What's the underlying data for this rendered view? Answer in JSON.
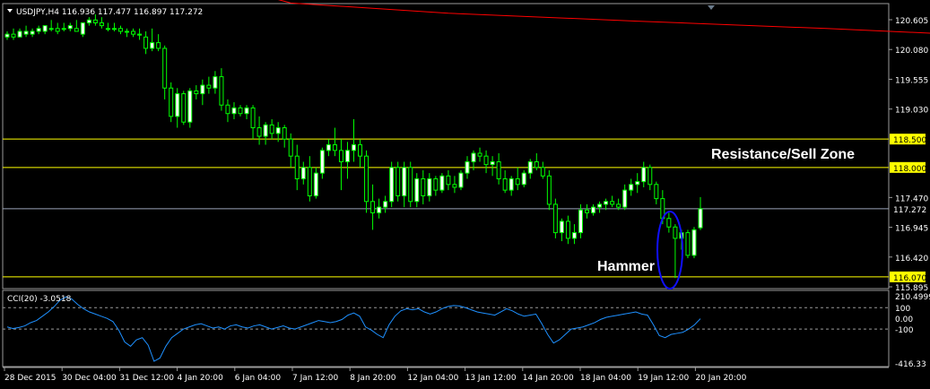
{
  "header": {
    "symbol_line": "USDJPY,H4  116.936 117.477 116.897 117.272",
    "cci_label": "CCI(20) -3.0518"
  },
  "annotations": {
    "resistance": "Resistance/Sell Zone",
    "hammer": "Hammer"
  },
  "colors": {
    "background": "#000000",
    "bull_candle": "#ffffff",
    "candle_outline": "#00ff00",
    "ma_line": "#ff0000",
    "level_line": "#ffff00",
    "cci_line": "#1e90ff",
    "hammer_ellipse": "#0000ff"
  },
  "chart_data": [
    {
      "type": "candlestick",
      "symbol": "USDJPY",
      "timeframe": "H4",
      "last": {
        "open": 116.936,
        "high": 117.477,
        "low": 116.897,
        "close": 117.272
      },
      "y_ticks": [
        120.605,
        120.08,
        119.555,
        119.03,
        117.47,
        116.945,
        116.42,
        115.895
      ],
      "ylim": [
        115.75,
        120.85
      ],
      "level_labels": [
        "118.500",
        "118.000",
        "117.272",
        "116.070"
      ],
      "levels": [
        {
          "value": 118.5,
          "color": "#ffff00"
        },
        {
          "value": 118.0,
          "color": "#ffff00"
        },
        {
          "value": 117.272,
          "color": "#9aa4b8"
        },
        {
          "value": 116.07,
          "color": "#ffff00"
        }
      ],
      "x_tick_labels": [
        "28 Dec 2015",
        "30 Dec 04:00",
        "31 Dec 12:00",
        "4 Jan 20:00",
        "6 Jan 04:00",
        "7 Jan 12:00",
        "8 Jan 20:00",
        "12 Jan 04:00",
        "13 Jan 12:00",
        "14 Jan 20:00",
        "18 Jan 04:00",
        "19 Jan 12:00",
        "20 Jan 20:00"
      ],
      "ohlc": [
        [
          120.3,
          120.4,
          120.25,
          120.35
        ],
        [
          120.35,
          120.45,
          120.25,
          120.3
        ],
        [
          120.3,
          120.45,
          120.3,
          120.4
        ],
        [
          120.35,
          120.5,
          120.3,
          120.4
        ],
        [
          120.35,
          120.45,
          120.3,
          120.4
        ],
        [
          120.4,
          120.5,
          120.35,
          120.45
        ],
        [
          120.4,
          120.5,
          120.35,
          120.5
        ],
        [
          120.45,
          120.6,
          120.4,
          120.45
        ],
        [
          120.45,
          120.55,
          120.35,
          120.4
        ],
        [
          120.45,
          120.55,
          120.4,
          120.45
        ],
        [
          120.45,
          120.55,
          120.4,
          120.5
        ],
        [
          120.45,
          120.6,
          120.4,
          120.4
        ],
        [
          120.35,
          120.55,
          120.3,
          120.55
        ],
        [
          120.55,
          120.65,
          120.5,
          120.6
        ],
        [
          120.6,
          120.7,
          120.5,
          120.55
        ],
        [
          120.55,
          120.65,
          120.45,
          120.5
        ],
        [
          120.45,
          120.55,
          120.4,
          120.45
        ],
        [
          120.45,
          120.55,
          120.4,
          120.45
        ],
        [
          120.45,
          120.5,
          120.35,
          120.4
        ],
        [
          120.4,
          120.45,
          120.3,
          120.4
        ],
        [
          120.4,
          120.45,
          120.3,
          120.35
        ],
        [
          120.35,
          120.45,
          120.25,
          120.35
        ],
        [
          120.3,
          120.4,
          120.0,
          120.1
        ],
        [
          120.1,
          120.45,
          120.05,
          120.2
        ],
        [
          120.2,
          120.35,
          120.05,
          120.1
        ],
        [
          120.1,
          120.15,
          119.2,
          119.4
        ],
        [
          119.4,
          119.5,
          118.8,
          118.9
        ],
        [
          118.9,
          119.4,
          118.7,
          119.3
        ],
        [
          119.3,
          119.35,
          118.75,
          118.8
        ],
        [
          118.8,
          119.4,
          118.7,
          119.35
        ],
        [
          119.35,
          119.45,
          119.2,
          119.3
        ],
        [
          119.3,
          119.55,
          119.1,
          119.45
        ],
        [
          119.45,
          119.6,
          119.3,
          119.4
        ],
        [
          119.4,
          119.7,
          119.3,
          119.6
        ],
        [
          119.6,
          119.75,
          119.0,
          119.1
        ],
        [
          119.1,
          119.2,
          118.8,
          118.95
        ],
        [
          118.95,
          119.15,
          118.85,
          119.05
        ],
        [
          119.05,
          119.1,
          118.9,
          118.95
        ],
        [
          118.95,
          119.1,
          118.85,
          119.05
        ],
        [
          119.05,
          119.1,
          118.5,
          118.7
        ],
        [
          118.7,
          118.9,
          118.4,
          118.55
        ],
        [
          118.55,
          118.8,
          118.4,
          118.75
        ],
        [
          118.75,
          118.85,
          118.5,
          118.6
        ],
        [
          118.6,
          118.8,
          118.45,
          118.7
        ],
        [
          118.7,
          118.75,
          118.35,
          118.5
        ],
        [
          118.5,
          118.6,
          118.0,
          118.2
        ],
        [
          118.2,
          118.4,
          117.6,
          117.8
        ],
        [
          117.8,
          118.1,
          117.7,
          118.0
        ],
        [
          118.0,
          118.2,
          117.4,
          117.5
        ],
        [
          117.5,
          118.0,
          117.45,
          117.9
        ],
        [
          117.9,
          118.35,
          117.8,
          118.3
        ],
        [
          118.3,
          118.5,
          118.2,
          118.4
        ],
        [
          118.4,
          118.7,
          118.2,
          118.3
        ],
        [
          118.3,
          118.5,
          117.6,
          118.1
        ],
        [
          118.1,
          118.45,
          117.8,
          118.3
        ],
        [
          118.3,
          118.85,
          118.1,
          118.4
        ],
        [
          118.4,
          118.5,
          118.0,
          118.2
        ],
        [
          118.2,
          118.3,
          117.2,
          117.4
        ],
        [
          117.4,
          117.7,
          116.9,
          117.2
        ],
        [
          117.2,
          117.45,
          117.1,
          117.3
        ],
        [
          117.3,
          117.5,
          117.2,
          117.4
        ],
        [
          117.4,
          118.1,
          117.3,
          118.0
        ],
        [
          118.0,
          118.1,
          117.4,
          117.5
        ],
        [
          117.5,
          118.1,
          117.3,
          118.0
        ],
        [
          118.0,
          118.1,
          117.3,
          117.4
        ],
        [
          117.4,
          117.9,
          117.3,
          117.8
        ],
        [
          117.8,
          117.95,
          117.35,
          117.5
        ],
        [
          117.5,
          117.9,
          117.4,
          117.8
        ],
        [
          117.8,
          117.85,
          117.5,
          117.6
        ],
        [
          117.6,
          117.9,
          117.55,
          117.85
        ],
        [
          117.85,
          117.95,
          117.6,
          117.7
        ],
        [
          117.7,
          117.85,
          117.55,
          117.65
        ],
        [
          117.65,
          117.95,
          117.6,
          117.9
        ],
        [
          117.9,
          118.2,
          117.8,
          118.1
        ],
        [
          118.1,
          118.3,
          117.95,
          118.25
        ],
        [
          118.25,
          118.35,
          118.1,
          118.2
        ],
        [
          118.2,
          118.3,
          117.9,
          118.05
        ],
        [
          118.05,
          118.2,
          117.85,
          118.1
        ],
        [
          118.1,
          118.25,
          117.7,
          117.8
        ],
        [
          117.8,
          117.95,
          117.55,
          117.6
        ],
        [
          117.6,
          117.85,
          117.5,
          117.8
        ],
        [
          117.8,
          118.0,
          117.6,
          117.7
        ],
        [
          117.7,
          117.95,
          117.65,
          117.9
        ],
        [
          117.9,
          118.15,
          117.8,
          118.1
        ],
        [
          118.1,
          118.25,
          117.95,
          118.0
        ],
        [
          118.0,
          118.1,
          117.8,
          117.85
        ],
        [
          117.85,
          117.95,
          117.25,
          117.35
        ],
        [
          117.35,
          117.45,
          116.75,
          116.85
        ],
        [
          116.85,
          117.1,
          116.7,
          117.05
        ],
        [
          117.05,
          117.15,
          116.65,
          116.75
        ],
        [
          116.75,
          117.0,
          116.65,
          116.85
        ],
        [
          116.85,
          117.35,
          116.75,
          117.25
        ],
        [
          117.25,
          117.35,
          117.1,
          117.2
        ],
        [
          117.2,
          117.35,
          117.15,
          117.3
        ],
        [
          117.3,
          117.4,
          117.2,
          117.35
        ],
        [
          117.35,
          117.45,
          117.25,
          117.4
        ],
        [
          117.4,
          117.5,
          117.3,
          117.35
        ],
        [
          117.35,
          117.45,
          117.25,
          117.3
        ],
        [
          117.3,
          117.7,
          117.25,
          117.6
        ],
        [
          117.6,
          117.8,
          117.5,
          117.7
        ],
        [
          117.7,
          117.9,
          117.55,
          117.75
        ],
        [
          117.75,
          118.1,
          117.65,
          118.0
        ],
        [
          118.0,
          118.05,
          117.6,
          117.7
        ],
        [
          117.7,
          117.75,
          117.35,
          117.45
        ],
        [
          117.45,
          117.6,
          117.0,
          117.1
        ],
        [
          117.1,
          117.2,
          116.85,
          116.95
        ],
        [
          116.95,
          117.0,
          116.05,
          116.75
        ],
        [
          116.75,
          116.9,
          116.55,
          116.85
        ],
        [
          116.85,
          116.9,
          116.4,
          116.45
        ],
        [
          116.45,
          116.95,
          116.4,
          116.9
        ],
        [
          116.936,
          117.477,
          116.897,
          117.272
        ]
      ],
      "ma200": [
        [
          25,
          121.5
        ],
        [
          45,
          120.9
        ],
        [
          70,
          120.72
        ],
        [
          100,
          120.58
        ],
        [
          130,
          120.45
        ],
        [
          150,
          120.35
        ],
        [
          165,
          120.28
        ],
        [
          180,
          120.2
        ],
        [
          200,
          120.07
        ],
        [
          215,
          119.97
        ],
        [
          230,
          119.9
        ],
        [
          237,
          119.78
        ],
        [
          246,
          119.62
        ]
      ]
    },
    {
      "type": "line",
      "name": "CCI(20) -3.0518",
      "y_ticks": [
        "210.4999",
        "100",
        "0.00",
        "-100",
        "-416.33"
      ],
      "ylim": [
        -416.33,
        210.4999
      ],
      "levels": [
        100,
        -100
      ],
      "values": [
        -80,
        -95,
        -85,
        -70,
        -40,
        -20,
        20,
        60,
        110,
        170,
        200,
        180,
        130,
        90,
        60,
        40,
        20,
        0,
        -30,
        -110,
        -220,
        -260,
        -200,
        -180,
        -250,
        -400,
        -370,
        -260,
        -180,
        -140,
        -100,
        -80,
        -60,
        -50,
        -70,
        -90,
        -80,
        -100,
        -70,
        -60,
        -80,
        -90,
        -70,
        -60,
        -80,
        -100,
        -85,
        -70,
        -90,
        -100,
        -80,
        -60,
        -40,
        -20,
        -30,
        -40,
        -30,
        -10,
        30,
        50,
        20,
        -80,
        -110,
        -150,
        -180,
        -60,
        20,
        70,
        90,
        80,
        90,
        60,
        40,
        60,
        90,
        110,
        120,
        115,
        100,
        80,
        60,
        50,
        40,
        30,
        60,
        90,
        70,
        40,
        20,
        30,
        40,
        -50,
        -150,
        -230,
        -200,
        -150,
        -100,
        -90,
        -80,
        -60,
        -40,
        -10,
        10,
        20,
        30,
        40,
        50,
        60,
        40,
        30,
        -60,
        -160,
        -180,
        -150,
        -140,
        -130,
        -100,
        -60,
        -3
      ]
    }
  ]
}
